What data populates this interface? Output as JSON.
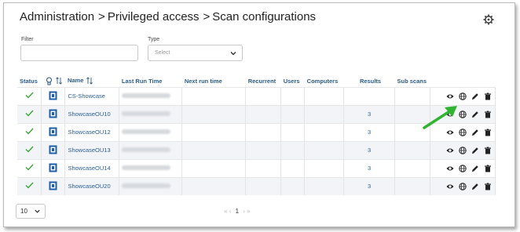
{
  "breadcrumb": [
    "Administration",
    "Privileged access",
    "Scan configurations"
  ],
  "breadcrumb_separator": ">",
  "filters": {
    "filter_label": "Filter",
    "filter_value": "",
    "type_label": "Type",
    "type_placeholder": "Select"
  },
  "table": {
    "columns": {
      "status": "Status",
      "name": "Name",
      "last_run": "Last Run Time",
      "next_run": "Next run time",
      "recurrent": "Recurrent",
      "users": "Users",
      "computers": "Computers",
      "results": "Results",
      "sub_scans": "Sub scans"
    },
    "rows": [
      {
        "name": "CS-Showcase",
        "results": ""
      },
      {
        "name": "ShowcaseOU10",
        "results": "3"
      },
      {
        "name": "ShowcaseOU12",
        "results": "3"
      },
      {
        "name": "ShowcaseOU13",
        "results": "3"
      },
      {
        "name": "ShowcaseOU14",
        "results": "3"
      },
      {
        "name": "ShowcaseOU20",
        "results": "3"
      }
    ]
  },
  "pagination": {
    "page_size": "10",
    "first": "«",
    "prev": "‹",
    "current_page": "1",
    "next": "›",
    "last": "»"
  },
  "colors": {
    "link": "#2a5e96",
    "header_text": "#2b5c8a",
    "status_ok": "#3aa63a",
    "annotation_arrow": "#2fb52f"
  },
  "icons": {
    "gear": "gear-icon",
    "status": "check-icon",
    "scan_type": "ad-scan-icon",
    "view": "eye-icon",
    "run": "globe-icon",
    "edit": "pencil-icon",
    "delete": "trash-icon"
  }
}
